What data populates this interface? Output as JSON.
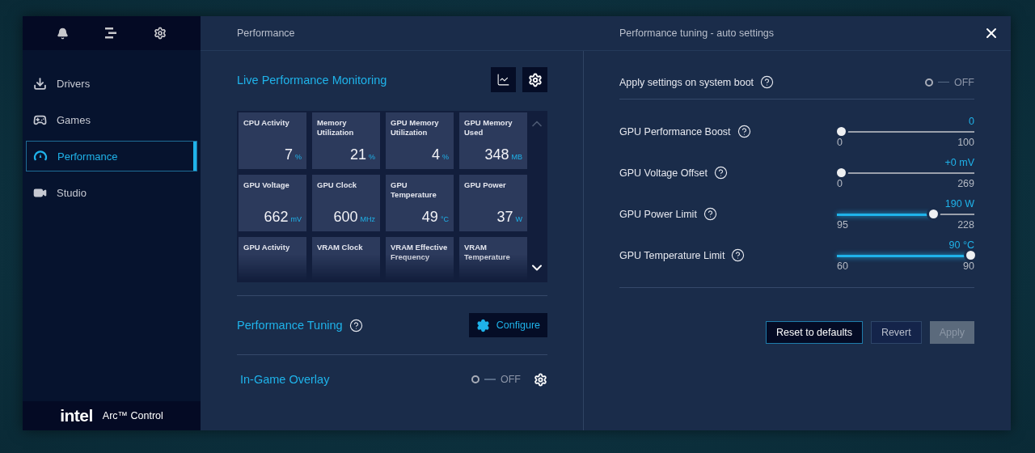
{
  "sidebar": {
    "items": [
      {
        "label": "Drivers",
        "kind": "download",
        "selected": false
      },
      {
        "label": "Games",
        "kind": "gamepad",
        "selected": false
      },
      {
        "label": "Performance",
        "kind": "gauge",
        "selected": true
      },
      {
        "label": "Studio",
        "kind": "camera",
        "selected": false
      }
    ],
    "footer": {
      "brand": "intel",
      "product": "Arc™ Control"
    }
  },
  "header": {
    "title": "Performance",
    "panel_title": "Performance tuning - auto settings"
  },
  "monitoring": {
    "title": "Live Performance Monitoring",
    "tiles": [
      {
        "label": "CPU Activity",
        "value": "7",
        "unit": "%"
      },
      {
        "label": "Memory Utilization",
        "value": "21",
        "unit": "%"
      },
      {
        "label": "GPU Memory Utilization",
        "value": "4",
        "unit": "%"
      },
      {
        "label": "GPU Memory Used",
        "value": "348",
        "unit": "MB"
      },
      {
        "label": "GPU Voltage",
        "value": "662",
        "unit": "mV"
      },
      {
        "label": "GPU Clock",
        "value": "600",
        "unit": "MHz"
      },
      {
        "label": "GPU Temperature",
        "value": "49",
        "unit": "°C"
      },
      {
        "label": "GPU Power",
        "value": "37",
        "unit": "W"
      },
      {
        "label": "GPU Activity"
      },
      {
        "label": "VRAM Clock"
      },
      {
        "label": "VRAM Effective Frequency"
      },
      {
        "label": "VRAM Temperature"
      }
    ]
  },
  "tuning": {
    "title": "Performance Tuning",
    "button": "Configure"
  },
  "overlay": {
    "title": "In-Game Overlay",
    "on": false,
    "state_label": "OFF"
  },
  "panel": {
    "boot": {
      "label": "Apply settings on system boot",
      "on": false,
      "state_label": "OFF"
    },
    "sliders": [
      {
        "label": "GPU Performance Boost",
        "value": "0",
        "min": "0",
        "max": "100",
        "level": 0
      },
      {
        "label": "GPU Voltage Offset",
        "value": "+0 mV",
        "min": "0",
        "max": "269",
        "level": 0
      },
      {
        "label": "GPU Power Limit",
        "value": "190 W",
        "min": "95",
        "max": "228",
        "level": 0.714
      },
      {
        "label": "GPU Temperature Limit",
        "value": "90 °C",
        "min": "60",
        "max": "90",
        "level": 1
      }
    ],
    "buttons": [
      {
        "label": "Reset to defaults",
        "kind": "outlined",
        "disabled": false
      },
      {
        "label": "Revert",
        "kind": "secondary",
        "disabled": false
      },
      {
        "label": "Apply",
        "kind": "filled",
        "disabled": true
      }
    ]
  }
}
